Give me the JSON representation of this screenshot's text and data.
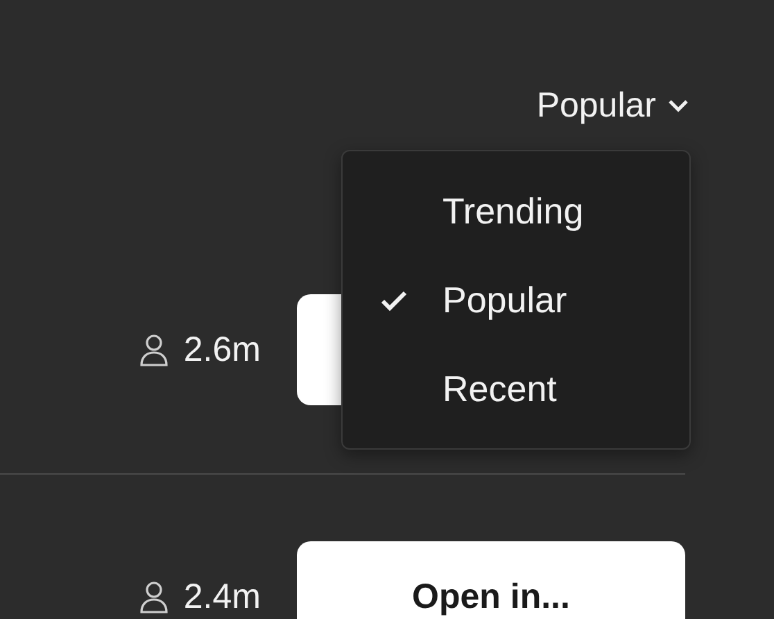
{
  "sort": {
    "label": "Popular"
  },
  "menu": {
    "items": [
      {
        "label": "Trending",
        "selected": false
      },
      {
        "label": "Popular",
        "selected": true
      },
      {
        "label": "Recent",
        "selected": false
      }
    ]
  },
  "rows": [
    {
      "views": "2.6m"
    },
    {
      "views": "2.4m",
      "button": "Open in..."
    }
  ]
}
